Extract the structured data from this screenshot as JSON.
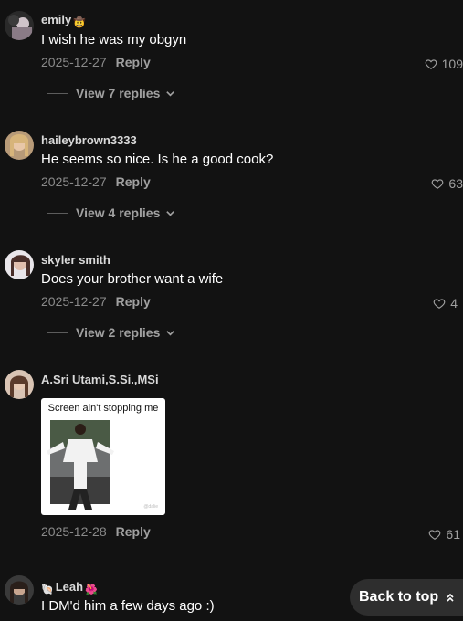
{
  "comments": [
    {
      "username": "emily",
      "username_emoji": "🤠",
      "text": "I wish he was my obgyn",
      "date": "2025-12-27",
      "reply_label": "Reply",
      "likes": "109",
      "view_replies": "View 7 replies"
    },
    {
      "username": "haileybrown3333",
      "text": "He seems so nice. Is he a good cook?",
      "date": "2025-12-27",
      "reply_label": "Reply",
      "likes": "63",
      "view_replies": "View 4 replies"
    },
    {
      "username": "skyler smith",
      "text": "Does your brother want a wife",
      "date": "2025-12-27",
      "reply_label": "Reply",
      "likes": "4",
      "view_replies": "View 2 replies"
    },
    {
      "username": "A.Sri  Utami,S.Si.,MSi",
      "gif_caption": "Screen ain't stopping me",
      "date": "2025-12-28",
      "reply_label": "Reply",
      "likes": "61"
    },
    {
      "username": "Leah",
      "username_emoji_before": "🐚",
      "username_emoji_after": "🌺",
      "text": "I DM'd him a few days ago :)"
    }
  ],
  "back_to_top": "Back to top",
  "colors": {
    "background": "#121212",
    "muted": "#8a8a8a",
    "button_bg": "#2e2e2e"
  },
  "icons": [
    "heart-icon",
    "chevron-down-icon",
    "chevron-double-up-icon"
  ]
}
